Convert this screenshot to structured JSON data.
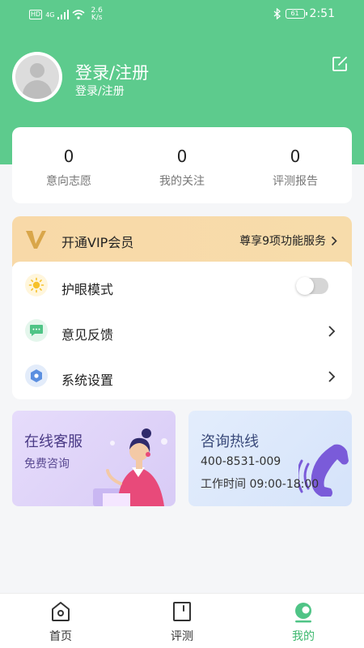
{
  "status_bar": {
    "hd_label": "HD",
    "network": "4G",
    "speed_value": "2.6",
    "speed_unit": "K/s",
    "battery": "61",
    "time": "2:51"
  },
  "profile": {
    "name": "登录/注册",
    "subtitle": "登录/注册"
  },
  "stats": [
    {
      "value": "0",
      "label": "意向志愿"
    },
    {
      "value": "0",
      "label": "我的关注"
    },
    {
      "value": "0",
      "label": "评测报告"
    }
  ],
  "vip": {
    "title": "开通VIP会员",
    "desc": "尊享9项功能服务"
  },
  "settings": [
    {
      "label": "护眼模式",
      "icon": "sun-icon",
      "toggle_on": false
    },
    {
      "label": "意见反馈",
      "icon": "feedback-icon"
    },
    {
      "label": "系统设置",
      "icon": "settings-hex-icon"
    }
  ],
  "service_card": {
    "title": "在线客服",
    "subtitle": "免费咨询"
  },
  "hotline_card": {
    "title": "咨询热线",
    "phone": "400-8531-009",
    "hours": "工作时间 09:00-18:00"
  },
  "nav": [
    {
      "label": "首页",
      "icon": "home-icon",
      "active": false
    },
    {
      "label": "评测",
      "icon": "test-icon",
      "active": false
    },
    {
      "label": "我的",
      "icon": "profile-icon",
      "active": true
    }
  ],
  "colors": {
    "primary_green": "#5dcb8d",
    "active_green": "#3db86e",
    "vip_gold": "#f8d9a8"
  }
}
